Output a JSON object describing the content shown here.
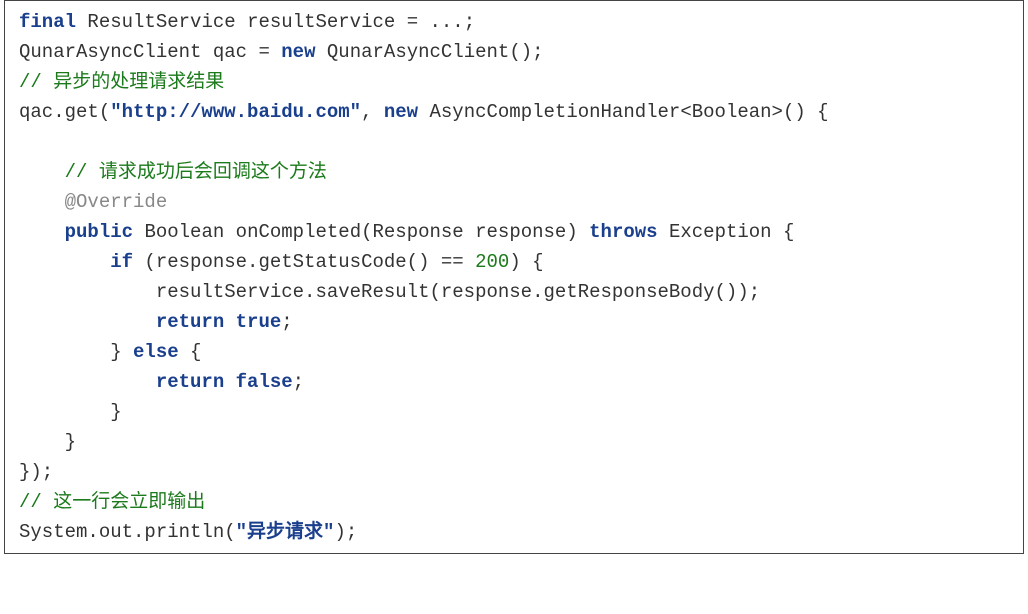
{
  "code": {
    "line1": {
      "kw_final": "final",
      "type": "ResultService",
      "var": "resultService",
      "rest": " = ...;"
    },
    "line2": {
      "type1": "QunarAsyncClient",
      "var": "qac",
      "eq": " = ",
      "kw_new": "new",
      "type2": " QunarAsyncClient();"
    },
    "line3_comment": "// 异步的处理请求结果",
    "line4": {
      "pre": "qac.get(",
      "str": "\"http://www.baidu.com\"",
      "mid": ", ",
      "kw_new": "new",
      "post": " AsyncCompletionHandler<Boolean>() {"
    },
    "blank5": "",
    "line6_comment": "    // 请求成功后会回调这个方法",
    "line7_ann": "    @Override",
    "line8": {
      "indent": "    ",
      "kw_public": "public",
      "sp1": " ",
      "ret": "Boolean",
      "sp2": " ",
      "name": "onCompleted(Response response) ",
      "kw_throws": "throws",
      "sp3": " ",
      "exc": "Exception {"
    },
    "line9": {
      "indent": "        ",
      "kw_if": "if",
      "cond_pre": " (response.getStatusCode() == ",
      "num": "200",
      "cond_post": ") {"
    },
    "line10": "            resultService.saveResult(response.getResponseBody());",
    "line11": {
      "indent": "            ",
      "kw_return": "return",
      "sp": " ",
      "kw_true": "true",
      "semi": ";"
    },
    "line12": {
      "indent": "        } ",
      "kw_else": "else",
      "post": " {"
    },
    "line13": {
      "indent": "            ",
      "kw_return": "return",
      "sp": " ",
      "kw_false": "false",
      "semi": ";"
    },
    "line14": "        }",
    "line15": "    }",
    "line16": "});",
    "line17_comment": "// 这一行会立即输出",
    "line18": {
      "pre": "System.out.println(",
      "str": "\"异步请求\"",
      "post": ");"
    }
  }
}
